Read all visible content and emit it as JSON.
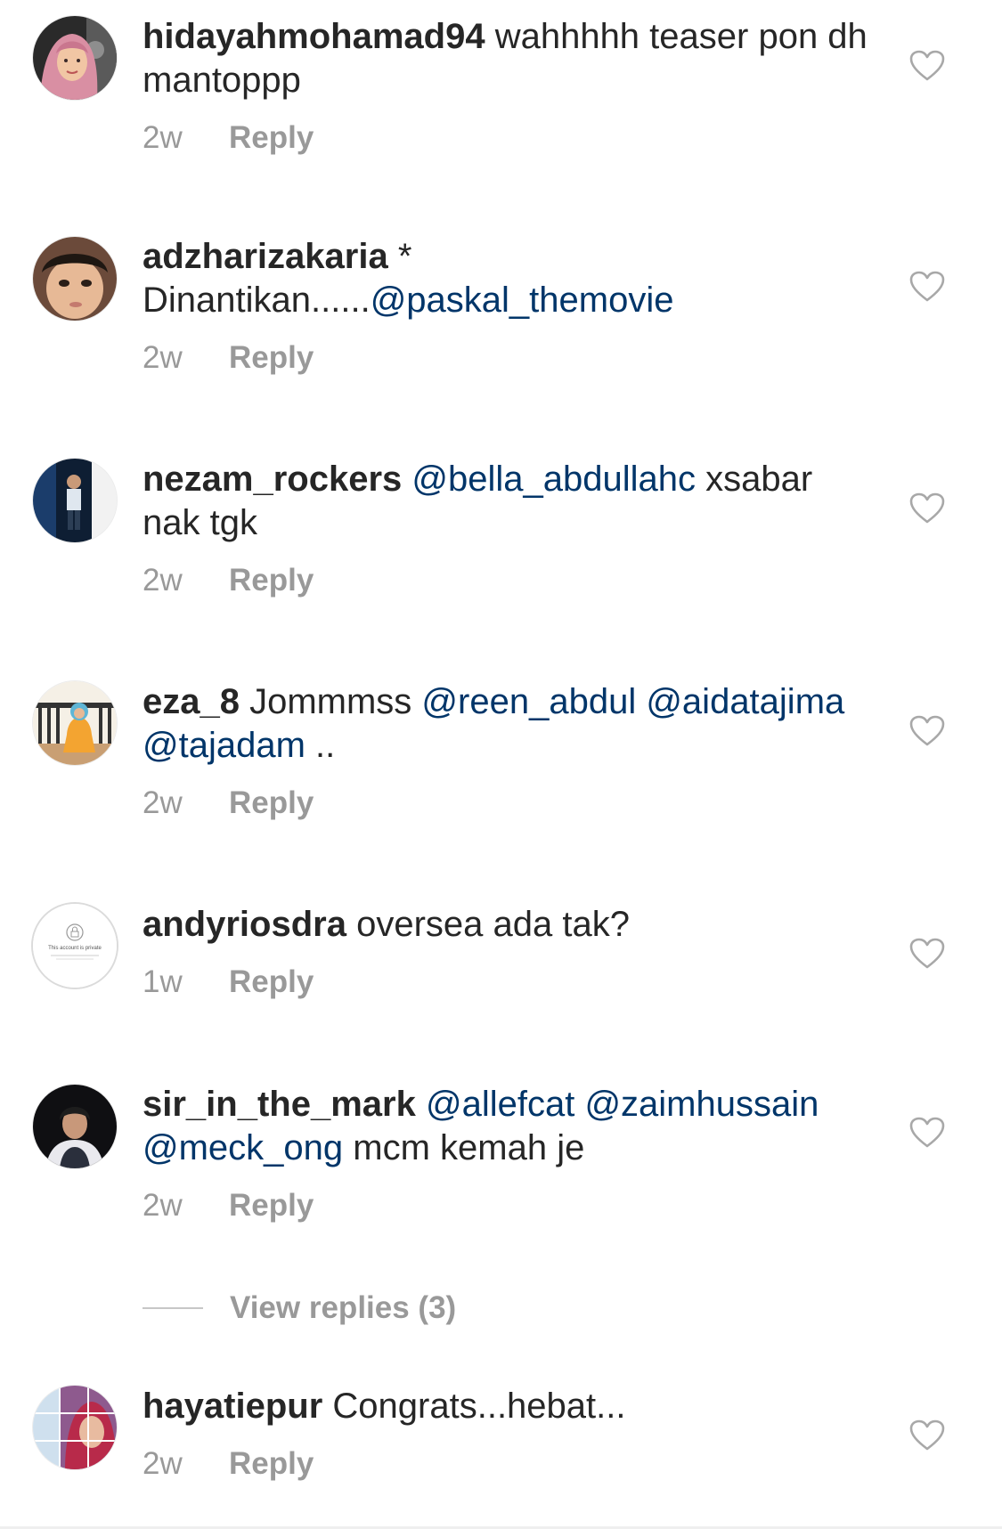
{
  "comments": [
    {
      "username": "hidayahmohamad94",
      "parts": [
        {
          "t": " wahhhhh teaser pon dh mantoppp",
          "m": false
        }
      ],
      "time": "2w",
      "reply": "Reply",
      "avatar_icon": "user-avatar"
    },
    {
      "username": "adzharizakaria",
      "parts": [
        {
          "t": " *",
          "m": false
        },
        {
          "t": " Dinantikan......",
          "m": false
        },
        {
          "t": "@paskal_themovie",
          "m": true
        }
      ],
      "time": "2w",
      "reply": "Reply",
      "avatar_icon": "user-avatar"
    },
    {
      "username": "nezam_rockers",
      "parts": [
        {
          "t": " ",
          "m": false
        },
        {
          "t": "@bella_abdullahc",
          "m": true
        },
        {
          "t": " xsabar nak tgk",
          "m": false
        }
      ],
      "time": "2w",
      "reply": "Reply",
      "avatar_icon": "user-avatar"
    },
    {
      "username": "eza_8",
      "parts": [
        {
          "t": " Jommmss ",
          "m": false
        },
        {
          "t": "@reen_abdul",
          "m": true
        },
        {
          "t": " ",
          "m": false
        },
        {
          "t": "@aidatajima",
          "m": true
        },
        {
          "t": " ",
          "m": false
        },
        {
          "t": "@tajadam",
          "m": true
        },
        {
          "t": " ..",
          "m": false
        }
      ],
      "time": "2w",
      "reply": "Reply",
      "avatar_icon": "user-avatar"
    },
    {
      "username": "andyriosdra",
      "parts": [
        {
          "t": " oversea ada tak?",
          "m": false
        }
      ],
      "time": "1w",
      "reply": "Reply",
      "avatar_icon": "private-account-avatar",
      "avatar_caption": "This account is private"
    },
    {
      "username": "sir_in_the_mark",
      "parts": [
        {
          "t": " ",
          "m": false
        },
        {
          "t": "@allefcat",
          "m": true
        },
        {
          "t": " ",
          "m": false
        },
        {
          "t": "@zaimhussain",
          "m": true
        },
        {
          "t": " ",
          "m": false
        },
        {
          "t": "@meck_ong",
          "m": true
        },
        {
          "t": " mcm kemah je",
          "m": false
        }
      ],
      "time": "2w",
      "reply": "Reply",
      "avatar_icon": "user-avatar"
    },
    {
      "username": "hayatiepur",
      "parts": [
        {
          "t": " Congrats...hebat...",
          "m": false
        }
      ],
      "time": "2w",
      "reply": "Reply",
      "avatar_icon": "user-avatar"
    }
  ],
  "view_replies": "View replies (3)",
  "like_icon": "heart-outline-icon",
  "colors": {
    "text": "#262626",
    "mention": "#003569",
    "meta": "#999999"
  }
}
